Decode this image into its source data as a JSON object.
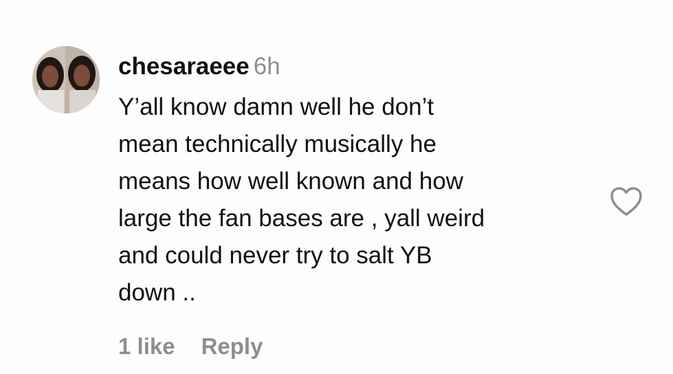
{
  "comment": {
    "username": "chesaraeee",
    "timestamp": "6h",
    "text_lines": [
      "Y’all know damn well he don’t",
      "mean technically musically he",
      "means how well known and how",
      "large the fan bases are , yall weird",
      "and could never try to salt YB",
      "down .."
    ],
    "likes_label": "1 like",
    "reply_label": "Reply",
    "like_icon": "heart-outline-icon"
  },
  "colors": {
    "primary_text": "#111111",
    "secondary_text": "#8e8e8e",
    "background": "#fdfdfd"
  }
}
